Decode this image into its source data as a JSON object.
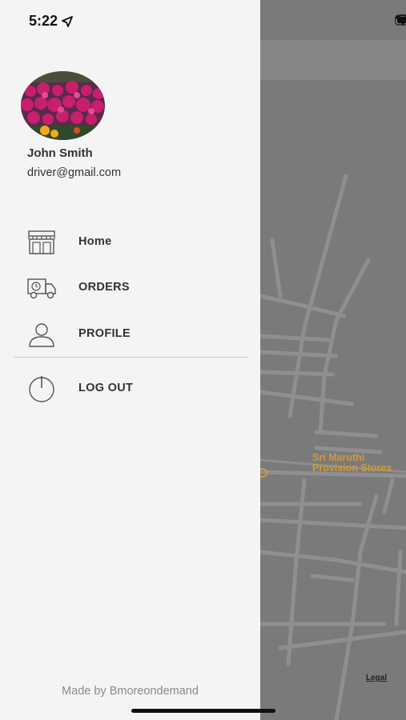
{
  "status_bar": {
    "time": "5:22",
    "location_icon": "location-arrow-icon",
    "signal_icon": "cellular-signal-icon",
    "wifi_icon": "wifi-icon",
    "battery_icon": "battery-icon"
  },
  "profile": {
    "name": "John Smith",
    "email": "driver@gmail.com",
    "avatar_icon": "avatar-flowers-image"
  },
  "menu": {
    "items": [
      {
        "label": "Home",
        "icon": "store-icon"
      },
      {
        "label": "ORDERS",
        "icon": "delivery-truck-icon"
      },
      {
        "label": "PROFILE",
        "icon": "user-icon"
      },
      {
        "label": "LOG OUT",
        "icon": "power-icon"
      }
    ]
  },
  "footer": {
    "text": "Made by Bmoreondemand"
  },
  "map": {
    "place_name_line1": "Sri Maruthi",
    "place_name_line2": "Provision Stores",
    "legal": "Legal",
    "header_power_icon": "power-icon"
  },
  "colors": {
    "drawer_bg": "#f4f4f4",
    "overlay": "#7a7a7a",
    "poi": "#d19a3a",
    "power_accent": "#c0392b"
  }
}
